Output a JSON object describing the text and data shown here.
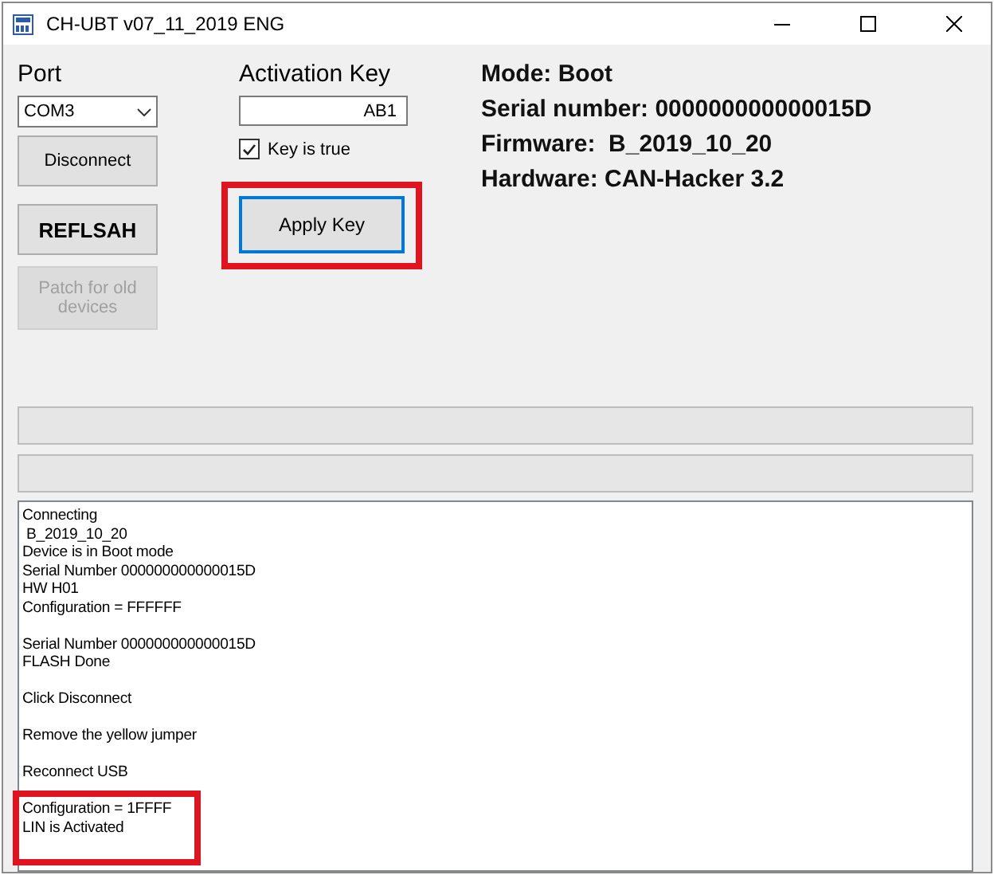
{
  "window": {
    "title": "CH-UBT v07_11_2019 ENG"
  },
  "port": {
    "label": "Port",
    "value": "COM3"
  },
  "buttons": [
    {
      "label": "Disconnect",
      "kind": "normal",
      "disabled": false
    },
    {
      "label": "REFLSAH",
      "kind": "bold",
      "disabled": false
    },
    {
      "label": "Patch for old devices",
      "kind": "normal",
      "disabled": true
    }
  ],
  "activation": {
    "label": "Activation Key",
    "value": "AB1",
    "checkbox": {
      "label": "Key is true",
      "checked": true
    },
    "apply_button": {
      "label": "Apply Key",
      "highlighted": true
    }
  },
  "info": [
    "Mode: Boot",
    "Serial number: 000000000000015D",
    "Firmware:  B_2019_10_20",
    "Hardware: CAN-Hacker 3.2"
  ],
  "progress_bars": [
    {
      "level": 0
    },
    {
      "level": 0
    }
  ],
  "log": [
    {
      "highlighted": false,
      "lines": [
        "Connecting",
        " B_2019_10_20",
        "Device is in Boot mode",
        "Serial Number 000000000000015D",
        "HW H01",
        "Configuration = FFFFFF"
      ]
    },
    {
      "highlighted": false,
      "lines": [
        "Serial Number 000000000000015D",
        "FLASH Done"
      ]
    },
    {
      "highlighted": false,
      "lines": [
        "Click Disconnect"
      ]
    },
    {
      "highlighted": false,
      "lines": [
        "Remove the yellow jumper"
      ]
    },
    {
      "highlighted": false,
      "lines": [
        "Reconnect USB"
      ]
    },
    {
      "highlighted": true,
      "lines": [
        "Configuration = 1FFFF",
        "LIN is Activated"
      ]
    }
  ]
}
